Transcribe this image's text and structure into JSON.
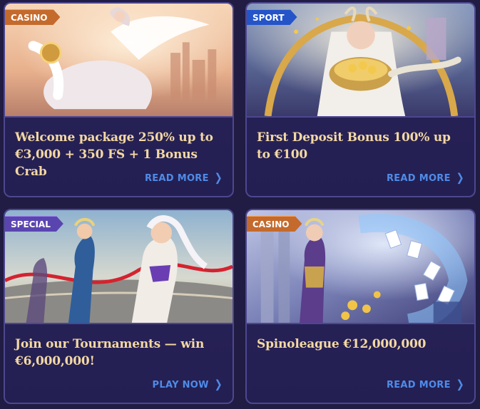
{
  "cards": [
    {
      "badge": "CASINO",
      "title": "Welcome package 250% up to €3,000 + 350 FS + 1 Bonus Crab",
      "cta": "READ MORE",
      "art": "pegasus-rider-illustration"
    },
    {
      "badge": "SPORT",
      "title": "First Deposit Bonus 100% up to €100",
      "cta": "READ MORE",
      "art": "goddess-with-coins-illustration"
    },
    {
      "badge": "SPECIAL",
      "title": "Join our Tournaments — win €6,000,000!",
      "cta": "PLAY NOW",
      "art": "runners-finish-line-illustration"
    },
    {
      "badge": "CASINO",
      "title": "Spinoleague €12,000,000",
      "cta": "READ MORE",
      "art": "goddess-with-cards-illustration"
    }
  ],
  "icons": {
    "cta_arrow": "chevron-right-icon"
  },
  "colors": {
    "background": "#201c43",
    "card_border": "#4d4790",
    "title_text": "#f3d8a3",
    "cta_text": "#4f8be8",
    "badge_casino": "#c46a2c",
    "badge_sport": "#2454c8",
    "badge_special": "#5a45b0"
  }
}
